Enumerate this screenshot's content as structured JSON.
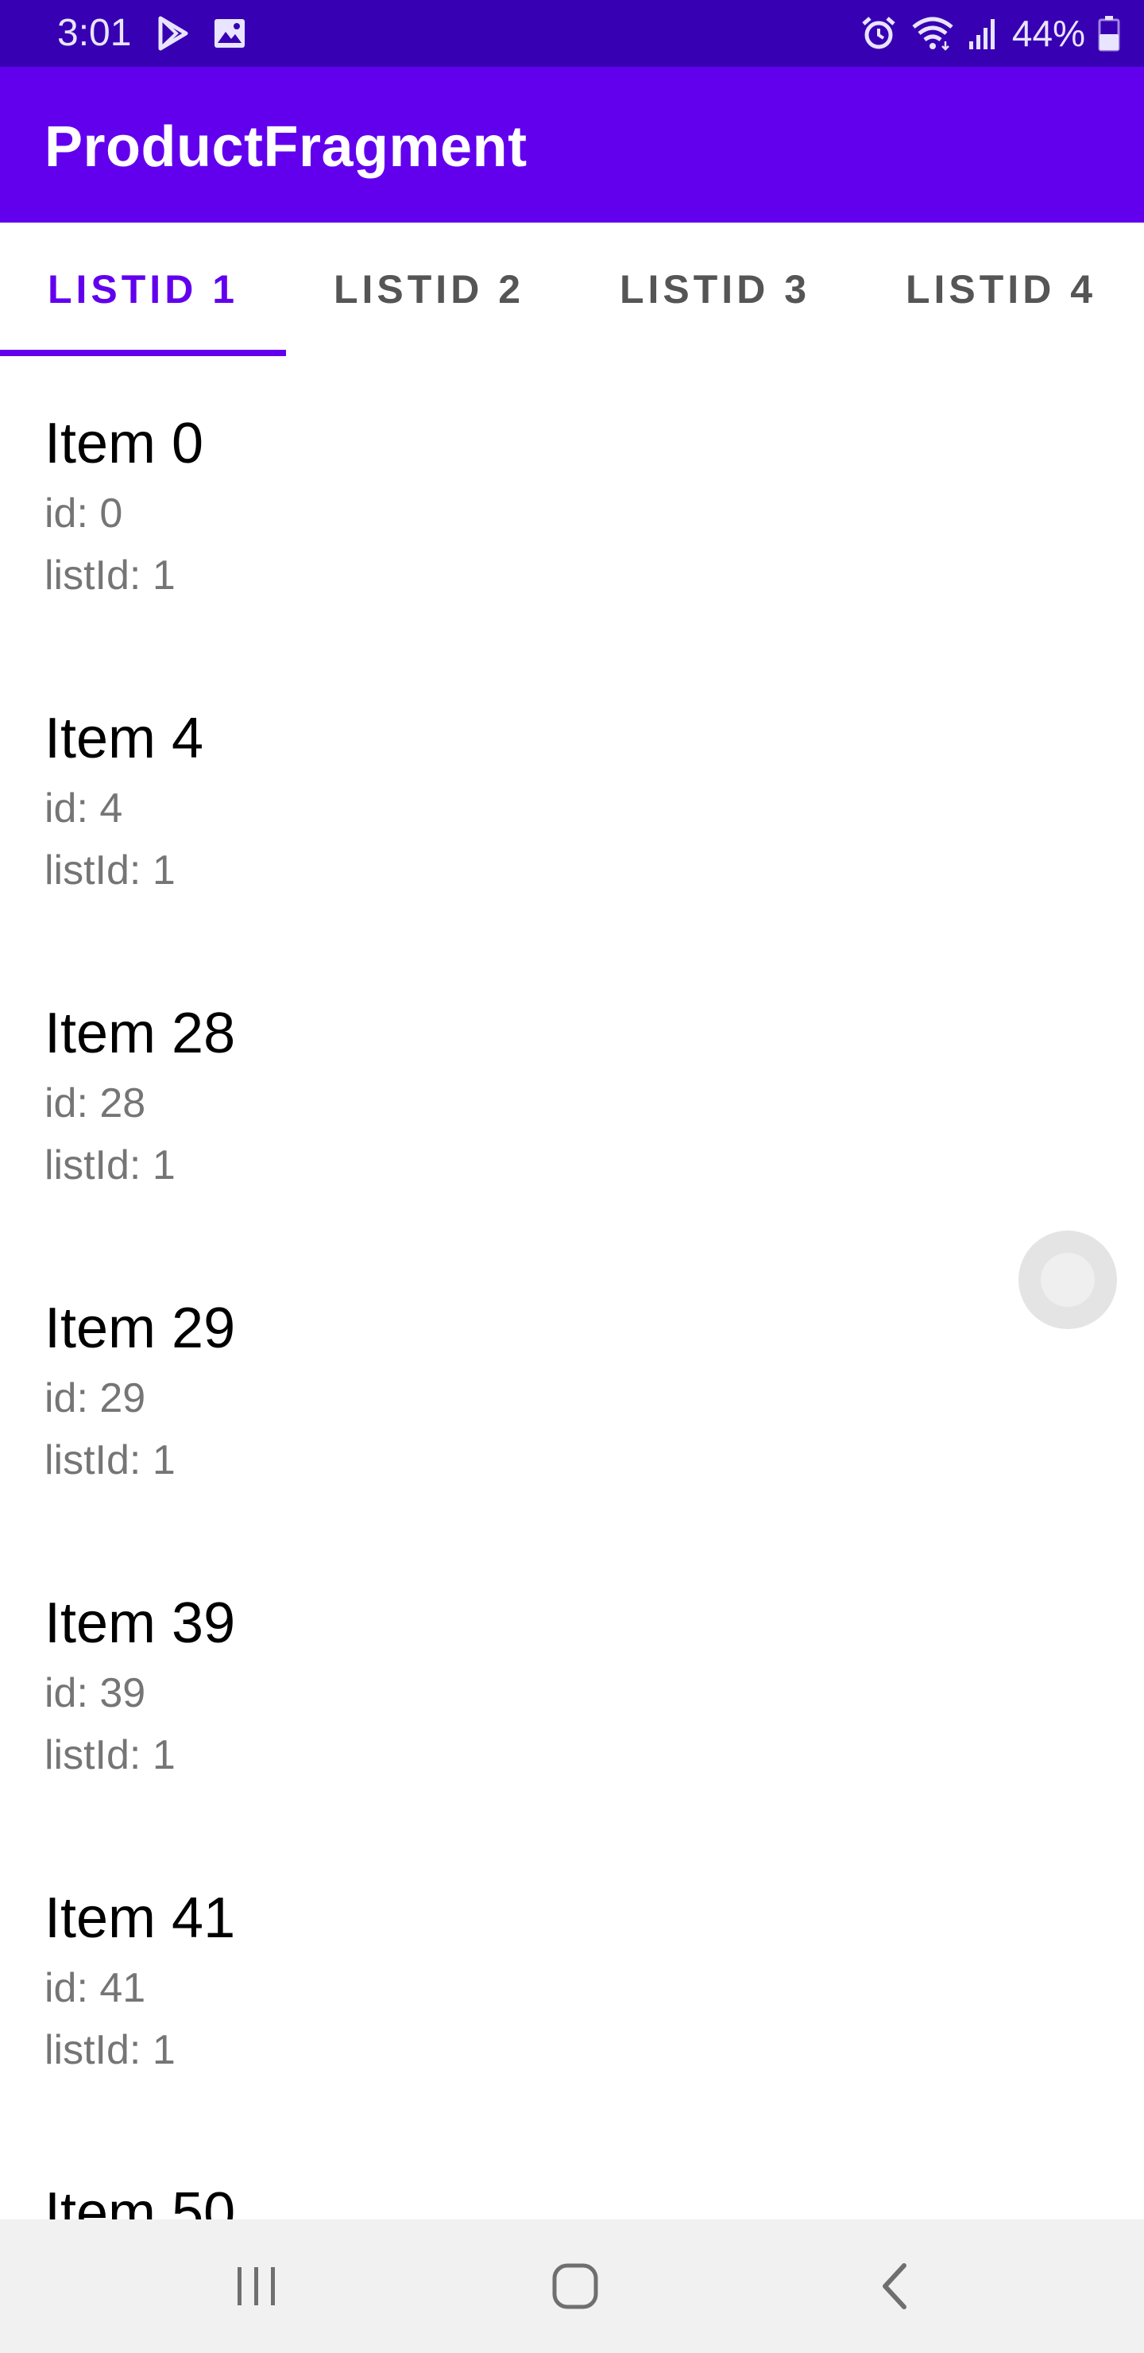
{
  "status_bar": {
    "time": "3:01",
    "left_icons": [
      "play-store-icon",
      "image-icon"
    ],
    "right_icons": [
      "alarm-icon",
      "wifi-icon",
      "signal-icon",
      "battery-icon"
    ],
    "battery_percent": "44%"
  },
  "app_bar": {
    "title": "ProductFragment",
    "color": "#6200ee"
  },
  "tabs": [
    {
      "label": "LISTID 1",
      "active": true
    },
    {
      "label": "LISTID 2",
      "active": false
    },
    {
      "label": "LISTID 3",
      "active": false
    },
    {
      "label": "LISTID 4",
      "active": false
    }
  ],
  "items": [
    {
      "name": "Item 0",
      "id": "id: 0",
      "list_id": "listId: 1"
    },
    {
      "name": "Item 4",
      "id": "id: 4",
      "list_id": "listId: 1"
    },
    {
      "name": "Item 28",
      "id": "id: 28",
      "list_id": "listId: 1"
    },
    {
      "name": "Item 29",
      "id": "id: 29",
      "list_id": "listId: 1"
    },
    {
      "name": "Item 39",
      "id": "id: 39",
      "list_id": "listId: 1"
    },
    {
      "name": "Item 41",
      "id": "id: 41",
      "list_id": "listId: 1"
    },
    {
      "name": "Item 50"
    }
  ],
  "navigation": [
    "recents-icon",
    "home-icon",
    "back-icon"
  ]
}
